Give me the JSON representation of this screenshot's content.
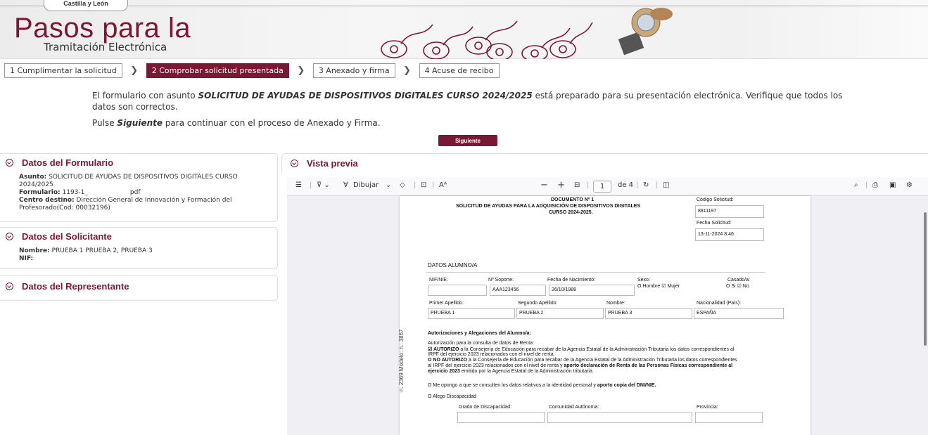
{
  "header": {
    "top_tab": "Castilla y León",
    "brand_title": "Pasos para la",
    "brand_subtitle": "Tramitación Electrónica"
  },
  "steps": [
    {
      "label": "1 Cumplimentar la solicitud"
    },
    {
      "label": "2 Comprobar solicitud presentada"
    },
    {
      "label": "3 Anexado y firma"
    },
    {
      "label": "4 Acuse de recibo"
    }
  ],
  "intro": {
    "p1_a": "El formulario con asunto ",
    "p1_subject": "SOLICITUD DE AYUDAS DE DISPOSITIVOS DIGITALES CURSO 2024/2025",
    "p1_b": " está preparado para su presentación electrónica. Verifique que todos los datos son correctos.",
    "p2_a": "Pulse ",
    "p2_bold": "Siguiente",
    "p2_b": " para continuar con el proceso de Anexado y Firma."
  },
  "next_button": "Siguiente",
  "panels": {
    "formulario": {
      "title": "Datos del Formulario",
      "asunto_label": "Asunto:",
      "asunto_value": "SOLICITUD DE AYUDAS DE DISPOSITIVOS DIGITALES CURSO 2024/2025",
      "formulario_label": "Formulario:",
      "formulario_value": "1193-1_",
      "formulario_ext": "pdf",
      "centro_label": "Centro destino:",
      "centro_value": "Dirección General de Innovación y Formación del Profesorado(Cod: 00032196)"
    },
    "solicitante": {
      "title": "Datos del Solicitante",
      "nombre_label": "Nombre:",
      "nombre_value": "PRUEBA 1 PRUEBA 2, PRUEBA 3",
      "nif_label": "NIF:"
    },
    "representante": {
      "title": "Datos del Representante"
    }
  },
  "preview": {
    "title": "Vista previa",
    "toolbar": {
      "draw_label": "Dibujar",
      "zoom_minus": "−",
      "zoom_plus": "+",
      "page_current": "1",
      "page_total": "de 4"
    }
  },
  "doc": {
    "line1": "DOCUMENTO Nº 1",
    "line2": "SOLICITUD DE AYUDAS PARA LA ADQUISICIÓN DE DISPOSITIVOS DIGITALES",
    "line3": "CURSO 2024-2025.",
    "codigo_label": "Código Solicitud:",
    "codigo_value": "8811197",
    "fecha_label": "Fecha Solicitud:",
    "fecha_value": "13-11-2024 8:46",
    "section_alumno": "DATOS ALUMNO/A",
    "nif_label": "NIF/NIE:",
    "soporte_label": "Nº Soporte:",
    "soporte_value": "AAA123456",
    "nacimiento_label": "Fecha de Nacimiento:",
    "nacimiento_value": "26/10/1988",
    "sexo_label": "Sexo:",
    "sexo_options": "O Hombre  ☑ Mujer",
    "casado_label": "Casado/a:",
    "casado_options": "O Si  ☑ No",
    "ap1_label": "Primer Apellido:",
    "ap1_value": "PRUEBA 1",
    "ap2_label": "Segundo Apellido:",
    "ap2_value": "PRUEBA 2",
    "nombre_label": "Nombre:",
    "nombre_value": "PRUEBA 3",
    "nac_label": "Nacionalidad (País):",
    "nac_value": "ESPAÑA",
    "autoriz_title": "Autorizaciones y Alegaciones del Alumno/a:",
    "autoriz_sub": "Autorización para la consulta de datos de Renta:",
    "aut1_bold": "☑ AUTORIZO",
    "aut1_text": " a la Consejería de Educación para recabar de la Agencia Estatal de la Administración Tributaria los datos correspondientes al",
    "aut1_text2": "IRPF del ejercicio 2023 relacionados con el nivel de renta.",
    "aut2_bold": "O NO AUTORIZO",
    "aut2_text": " a la Consejería de Educación para recabar de la Agencia Estatal de la Administración Tributaria los datos correspondientes",
    "aut2_text2a": "al IRPF del ejercicio 2023 relacionados con el nivel de renta y ",
    "aut2_text2b": "aporto declaración de Renta de las Personas Físicas correspondiente al",
    "aut2_text3a": "ejercicio 2023",
    "aut2_text3b": " emitido por la Agencia Estatal de la Administración tributaria.",
    "oponer_a": "O Me opongo a que se consulten los datos relativos a la identidad personal y ",
    "oponer_b": "aporto copia del DNI/NIE.",
    "discap": "O Alego Discapacidad",
    "grado_label": "Grado de Discapacidad:",
    "comunidad_label": "Comunidad Autónoma:",
    "provincia_label": "Provincia:",
    "side_text": "n. 2369 Modelo: n.: 3867"
  }
}
